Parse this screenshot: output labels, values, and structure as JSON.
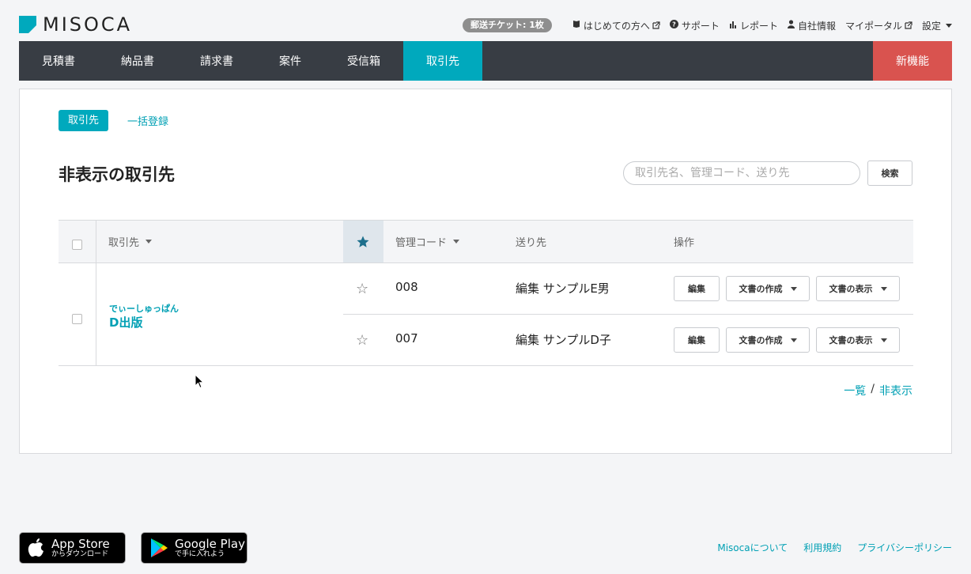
{
  "brand": {
    "logo_text": "MISOCA"
  },
  "topbar": {
    "ticket": "郵送チケット: 1枚",
    "links": [
      {
        "label": "はじめての方へ",
        "icon": "book-icon",
        "external": true
      },
      {
        "label": "サポート",
        "icon": "question-circle-icon"
      },
      {
        "label": "レポート",
        "icon": "bar-chart-icon"
      },
      {
        "label": "自社情報",
        "icon": "user-icon"
      },
      {
        "label": "マイポータル",
        "icon": "external-link-icon",
        "external": true
      },
      {
        "label": "設定",
        "icon": "chevron-down-icon"
      }
    ]
  },
  "nav": {
    "items": [
      {
        "label": "見積書"
      },
      {
        "label": "納品書"
      },
      {
        "label": "請求書"
      },
      {
        "label": "案件"
      },
      {
        "label": "受信箱"
      },
      {
        "label": "取引先",
        "active": true
      }
    ],
    "new_feature": "新機能"
  },
  "subtabs": {
    "active": "取引先",
    "bulk": "一括登録"
  },
  "page_title": "非表示の取引先",
  "search": {
    "placeholder": "取引先名、管理コード、送り先",
    "value": "",
    "button": "検索"
  },
  "table": {
    "headers": {
      "client": "取引先",
      "code": "管理コード",
      "dest": "送り先",
      "ops": "操作"
    },
    "client": {
      "kana": "でぃーしゅっぱん",
      "name": "D出版"
    },
    "rows": [
      {
        "code": "008",
        "dest": "編集 サンプルE男",
        "edit": "編集",
        "create": "文書の作成",
        "show": "文書の表示"
      },
      {
        "code": "007",
        "dest": "編集 サンプルD子",
        "edit": "編集",
        "create": "文書の作成",
        "show": "文書の表示"
      }
    ]
  },
  "pager": {
    "list": "一覧",
    "sep": "/",
    "hidden": "非表示"
  },
  "footer": {
    "app_store": {
      "line1": "App Store",
      "line2": "からダウンロード"
    },
    "google_play": {
      "line1": "Google Play",
      "line2": "で手に入れよう"
    },
    "links": [
      "Misocaについて",
      "利用規約",
      "プライバシーポリシー"
    ]
  },
  "colors": {
    "accent": "#00a9bd",
    "nav_bg": "#383d44",
    "new_feature": "#d9534f"
  }
}
